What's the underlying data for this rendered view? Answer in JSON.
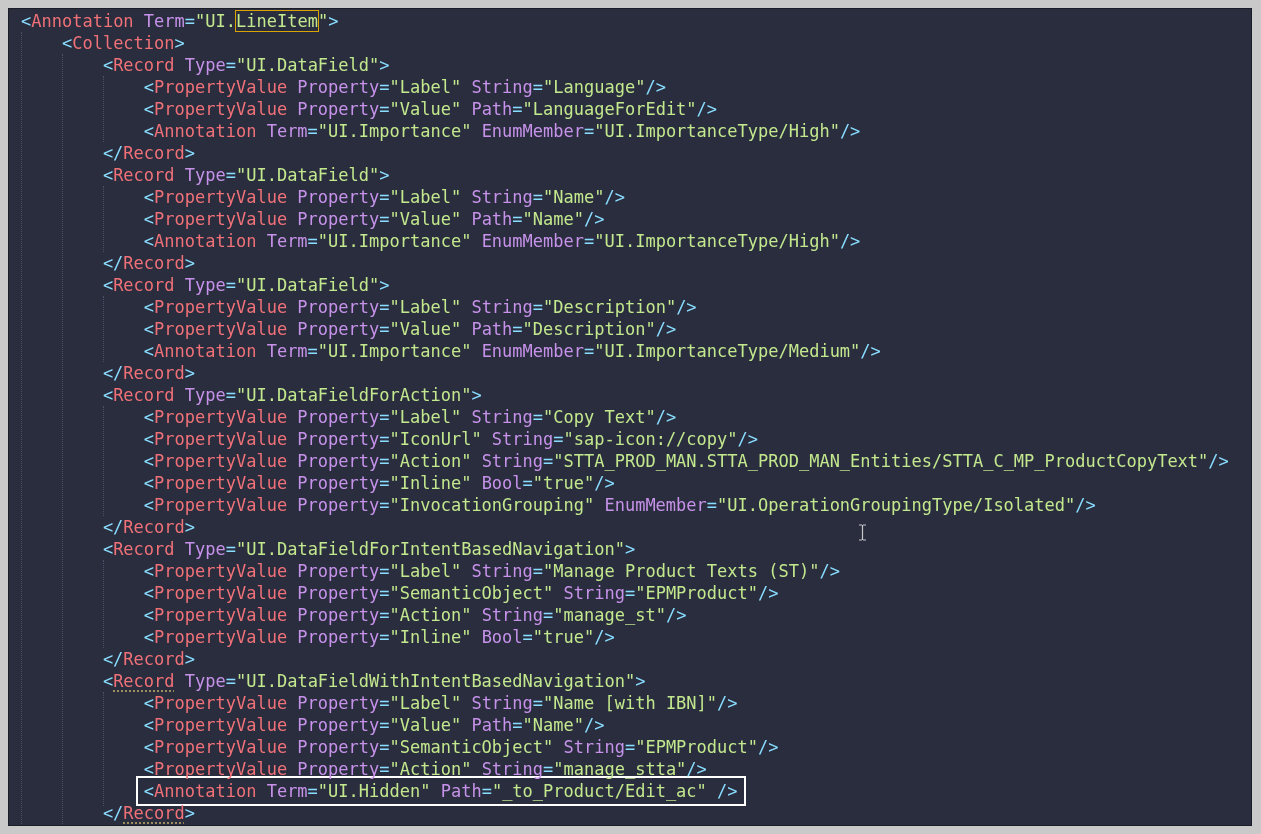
{
  "editor": {
    "lines": [
      {
        "open": [
          {
            "kind": "punct",
            "text": "<"
          },
          {
            "kind": "tag",
            "text": "Annotation"
          },
          {
            "kind": "attr",
            "text": " Term"
          },
          {
            "kind": "punct",
            "text": "="
          },
          {
            "kind": "string",
            "text": "\"UI."
          },
          {
            "kind": "string-matched",
            "text": "LineItem"
          },
          {
            "kind": "string",
            "text": "\""
          },
          {
            "kind": "punct",
            "text": ">"
          }
        ],
        "children": [
          {
            "open": [
              {
                "kind": "punct",
                "text": "<"
              },
              {
                "kind": "tag",
                "text": "Collection"
              },
              {
                "kind": "punct",
                "text": ">"
              }
            ],
            "children": [
              {
                "open": [
                  {
                    "kind": "punct",
                    "text": "<"
                  },
                  {
                    "kind": "tag",
                    "text": "Record"
                  },
                  {
                    "kind": "attr",
                    "text": " Type"
                  },
                  {
                    "kind": "punct",
                    "text": "="
                  },
                  {
                    "kind": "string",
                    "text": "\"UI.DataField\""
                  },
                  {
                    "kind": "punct",
                    "text": ">"
                  }
                ],
                "children": [
                  {
                    "open": [
                      {
                        "kind": "punct",
                        "text": "<"
                      },
                      {
                        "kind": "tag",
                        "text": "PropertyValue"
                      },
                      {
                        "kind": "attr",
                        "text": " Property"
                      },
                      {
                        "kind": "punct",
                        "text": "="
                      },
                      {
                        "kind": "string",
                        "text": "\"Label\""
                      },
                      {
                        "kind": "attr",
                        "text": " String"
                      },
                      {
                        "kind": "punct",
                        "text": "="
                      },
                      {
                        "kind": "string",
                        "text": "\"Language\""
                      },
                      {
                        "kind": "punct",
                        "text": "/>"
                      }
                    ]
                  },
                  {
                    "open": [
                      {
                        "kind": "punct",
                        "text": "<"
                      },
                      {
                        "kind": "tag",
                        "text": "PropertyValue"
                      },
                      {
                        "kind": "attr",
                        "text": " Property"
                      },
                      {
                        "kind": "punct",
                        "text": "="
                      },
                      {
                        "kind": "string",
                        "text": "\"Value\""
                      },
                      {
                        "kind": "attr",
                        "text": " Path"
                      },
                      {
                        "kind": "punct",
                        "text": "="
                      },
                      {
                        "kind": "string",
                        "text": "\"LanguageForEdit\""
                      },
                      {
                        "kind": "punct",
                        "text": "/>"
                      }
                    ]
                  },
                  {
                    "open": [
                      {
                        "kind": "punct",
                        "text": "<"
                      },
                      {
                        "kind": "tag",
                        "text": "Annotation"
                      },
                      {
                        "kind": "attr",
                        "text": " Term"
                      },
                      {
                        "kind": "punct",
                        "text": "="
                      },
                      {
                        "kind": "string",
                        "text": "\"UI.Importance\""
                      },
                      {
                        "kind": "attr",
                        "text": " EnumMember"
                      },
                      {
                        "kind": "punct",
                        "text": "="
                      },
                      {
                        "kind": "string",
                        "text": "\"UI.ImportanceType/High\""
                      },
                      {
                        "kind": "punct",
                        "text": "/>"
                      }
                    ]
                  }
                ],
                "close": [
                  {
                    "kind": "punct",
                    "text": "</"
                  },
                  {
                    "kind": "tag",
                    "text": "Record"
                  },
                  {
                    "kind": "punct",
                    "text": ">"
                  }
                ]
              },
              {
                "open": [
                  {
                    "kind": "punct",
                    "text": "<"
                  },
                  {
                    "kind": "tag",
                    "text": "Record"
                  },
                  {
                    "kind": "attr",
                    "text": " Type"
                  },
                  {
                    "kind": "punct",
                    "text": "="
                  },
                  {
                    "kind": "string",
                    "text": "\"UI.DataField\""
                  },
                  {
                    "kind": "punct",
                    "text": ">"
                  }
                ],
                "children": [
                  {
                    "open": [
                      {
                        "kind": "punct",
                        "text": "<"
                      },
                      {
                        "kind": "tag",
                        "text": "PropertyValue"
                      },
                      {
                        "kind": "attr",
                        "text": " Property"
                      },
                      {
                        "kind": "punct",
                        "text": "="
                      },
                      {
                        "kind": "string",
                        "text": "\"Label\""
                      },
                      {
                        "kind": "attr",
                        "text": " String"
                      },
                      {
                        "kind": "punct",
                        "text": "="
                      },
                      {
                        "kind": "string",
                        "text": "\"Name\""
                      },
                      {
                        "kind": "punct",
                        "text": "/>"
                      }
                    ]
                  },
                  {
                    "open": [
                      {
                        "kind": "punct",
                        "text": "<"
                      },
                      {
                        "kind": "tag",
                        "text": "PropertyValue"
                      },
                      {
                        "kind": "attr",
                        "text": " Property"
                      },
                      {
                        "kind": "punct",
                        "text": "="
                      },
                      {
                        "kind": "string",
                        "text": "\"Value\""
                      },
                      {
                        "kind": "attr",
                        "text": " Path"
                      },
                      {
                        "kind": "punct",
                        "text": "="
                      },
                      {
                        "kind": "string",
                        "text": "\"Name\""
                      },
                      {
                        "kind": "punct",
                        "text": "/>"
                      }
                    ]
                  },
                  {
                    "open": [
                      {
                        "kind": "punct",
                        "text": "<"
                      },
                      {
                        "kind": "tag",
                        "text": "Annotation"
                      },
                      {
                        "kind": "attr",
                        "text": " Term"
                      },
                      {
                        "kind": "punct",
                        "text": "="
                      },
                      {
                        "kind": "string",
                        "text": "\"UI.Importance\""
                      },
                      {
                        "kind": "attr",
                        "text": " EnumMember"
                      },
                      {
                        "kind": "punct",
                        "text": "="
                      },
                      {
                        "kind": "string",
                        "text": "\"UI.ImportanceType/High\""
                      },
                      {
                        "kind": "punct",
                        "text": "/>"
                      }
                    ]
                  }
                ],
                "close": [
                  {
                    "kind": "punct",
                    "text": "</"
                  },
                  {
                    "kind": "tag",
                    "text": "Record"
                  },
                  {
                    "kind": "punct",
                    "text": ">"
                  }
                ]
              },
              {
                "open": [
                  {
                    "kind": "punct",
                    "text": "<"
                  },
                  {
                    "kind": "tag",
                    "text": "Record"
                  },
                  {
                    "kind": "attr",
                    "text": " Type"
                  },
                  {
                    "kind": "punct",
                    "text": "="
                  },
                  {
                    "kind": "string",
                    "text": "\"UI.DataField\""
                  },
                  {
                    "kind": "punct",
                    "text": ">"
                  }
                ],
                "children": [
                  {
                    "open": [
                      {
                        "kind": "punct",
                        "text": "<"
                      },
                      {
                        "kind": "tag",
                        "text": "PropertyValue"
                      },
                      {
                        "kind": "attr",
                        "text": " Property"
                      },
                      {
                        "kind": "punct",
                        "text": "="
                      },
                      {
                        "kind": "string",
                        "text": "\"Label\""
                      },
                      {
                        "kind": "attr",
                        "text": " String"
                      },
                      {
                        "kind": "punct",
                        "text": "="
                      },
                      {
                        "kind": "string",
                        "text": "\"Description\""
                      },
                      {
                        "kind": "punct",
                        "text": "/>"
                      }
                    ]
                  },
                  {
                    "open": [
                      {
                        "kind": "punct",
                        "text": "<"
                      },
                      {
                        "kind": "tag",
                        "text": "PropertyValue"
                      },
                      {
                        "kind": "attr",
                        "text": " Property"
                      },
                      {
                        "kind": "punct",
                        "text": "="
                      },
                      {
                        "kind": "string",
                        "text": "\"Value\""
                      },
                      {
                        "kind": "attr",
                        "text": " Path"
                      },
                      {
                        "kind": "punct",
                        "text": "="
                      },
                      {
                        "kind": "string",
                        "text": "\"Description\""
                      },
                      {
                        "kind": "punct",
                        "text": "/>"
                      }
                    ]
                  },
                  {
                    "open": [
                      {
                        "kind": "punct",
                        "text": "<"
                      },
                      {
                        "kind": "tag",
                        "text": "Annotation"
                      },
                      {
                        "kind": "attr",
                        "text": " Term"
                      },
                      {
                        "kind": "punct",
                        "text": "="
                      },
                      {
                        "kind": "string",
                        "text": "\"UI.Importance\""
                      },
                      {
                        "kind": "attr",
                        "text": " EnumMember"
                      },
                      {
                        "kind": "punct",
                        "text": "="
                      },
                      {
                        "kind": "string",
                        "text": "\"UI.ImportanceType/Medium\""
                      },
                      {
                        "kind": "punct",
                        "text": "/>"
                      }
                    ]
                  }
                ],
                "close": [
                  {
                    "kind": "punct",
                    "text": "</"
                  },
                  {
                    "kind": "tag",
                    "text": "Record"
                  },
                  {
                    "kind": "punct",
                    "text": ">"
                  }
                ]
              },
              {
                "open": [
                  {
                    "kind": "punct",
                    "text": "<"
                  },
                  {
                    "kind": "tag",
                    "text": "Record"
                  },
                  {
                    "kind": "attr",
                    "text": " Type"
                  },
                  {
                    "kind": "punct",
                    "text": "="
                  },
                  {
                    "kind": "string",
                    "text": "\"UI.DataFieldForAction\""
                  },
                  {
                    "kind": "punct",
                    "text": ">"
                  }
                ],
                "children": [
                  {
                    "open": [
                      {
                        "kind": "punct",
                        "text": "<"
                      },
                      {
                        "kind": "tag",
                        "text": "PropertyValue"
                      },
                      {
                        "kind": "attr",
                        "text": " Property"
                      },
                      {
                        "kind": "punct",
                        "text": "="
                      },
                      {
                        "kind": "string",
                        "text": "\"Label\""
                      },
                      {
                        "kind": "attr",
                        "text": " String"
                      },
                      {
                        "kind": "punct",
                        "text": "="
                      },
                      {
                        "kind": "string",
                        "text": "\"Copy Text\""
                      },
                      {
                        "kind": "punct",
                        "text": "/>"
                      }
                    ]
                  },
                  {
                    "open": [
                      {
                        "kind": "punct",
                        "text": "<"
                      },
                      {
                        "kind": "tag",
                        "text": "PropertyValue"
                      },
                      {
                        "kind": "attr",
                        "text": " Property"
                      },
                      {
                        "kind": "punct",
                        "text": "="
                      },
                      {
                        "kind": "string",
                        "text": "\"IconUrl\""
                      },
                      {
                        "kind": "attr",
                        "text": " String"
                      },
                      {
                        "kind": "punct",
                        "text": "="
                      },
                      {
                        "kind": "string",
                        "text": "\"sap-icon://copy\""
                      },
                      {
                        "kind": "punct",
                        "text": "/>"
                      }
                    ]
                  },
                  {
                    "open": [
                      {
                        "kind": "punct",
                        "text": "<"
                      },
                      {
                        "kind": "tag",
                        "text": "PropertyValue"
                      },
                      {
                        "kind": "attr",
                        "text": " Property"
                      },
                      {
                        "kind": "punct",
                        "text": "="
                      },
                      {
                        "kind": "string",
                        "text": "\"Action\""
                      },
                      {
                        "kind": "attr",
                        "text": " String"
                      },
                      {
                        "kind": "punct",
                        "text": "="
                      },
                      {
                        "kind": "string",
                        "text": "\"STTA_PROD_MAN.STTA_PROD_MAN_Entities/STTA_C_MP_ProductCopyText\""
                      },
                      {
                        "kind": "punct",
                        "text": "/>"
                      }
                    ]
                  },
                  {
                    "open": [
                      {
                        "kind": "punct",
                        "text": "<"
                      },
                      {
                        "kind": "tag",
                        "text": "PropertyValue"
                      },
                      {
                        "kind": "attr",
                        "text": " Property"
                      },
                      {
                        "kind": "punct",
                        "text": "="
                      },
                      {
                        "kind": "string",
                        "text": "\"Inline\""
                      },
                      {
                        "kind": "attr",
                        "text": " Bool"
                      },
                      {
                        "kind": "punct",
                        "text": "="
                      },
                      {
                        "kind": "string",
                        "text": "\"true\""
                      },
                      {
                        "kind": "punct",
                        "text": "/>"
                      }
                    ]
                  },
                  {
                    "open": [
                      {
                        "kind": "punct",
                        "text": "<"
                      },
                      {
                        "kind": "tag",
                        "text": "PropertyValue"
                      },
                      {
                        "kind": "attr",
                        "text": " Property"
                      },
                      {
                        "kind": "punct",
                        "text": "="
                      },
                      {
                        "kind": "string",
                        "text": "\"InvocationGrouping\""
                      },
                      {
                        "kind": "attr",
                        "text": " EnumMember"
                      },
                      {
                        "kind": "punct",
                        "text": "="
                      },
                      {
                        "kind": "string",
                        "text": "\"UI.OperationGroupingType/Isolated\""
                      },
                      {
                        "kind": "punct",
                        "text": "/>"
                      }
                    ]
                  }
                ],
                "close": [
                  {
                    "kind": "punct",
                    "text": "</"
                  },
                  {
                    "kind": "tag",
                    "text": "Record"
                  },
                  {
                    "kind": "punct",
                    "text": ">"
                  }
                ]
              },
              {
                "open": [
                  {
                    "kind": "punct",
                    "text": "<"
                  },
                  {
                    "kind": "tag",
                    "text": "Record"
                  },
                  {
                    "kind": "attr",
                    "text": " Type"
                  },
                  {
                    "kind": "punct",
                    "text": "="
                  },
                  {
                    "kind": "string",
                    "text": "\"UI.DataFieldForIntentBasedNavigation\""
                  },
                  {
                    "kind": "punct",
                    "text": ">"
                  }
                ],
                "children": [
                  {
                    "open": [
                      {
                        "kind": "punct",
                        "text": "<"
                      },
                      {
                        "kind": "tag",
                        "text": "PropertyValue"
                      },
                      {
                        "kind": "attr",
                        "text": " Property"
                      },
                      {
                        "kind": "punct",
                        "text": "="
                      },
                      {
                        "kind": "string",
                        "text": "\"Label\""
                      },
                      {
                        "kind": "attr",
                        "text": " String"
                      },
                      {
                        "kind": "punct",
                        "text": "="
                      },
                      {
                        "kind": "string",
                        "text": "\"Manage Product Texts (ST)\""
                      },
                      {
                        "kind": "punct",
                        "text": "/>"
                      }
                    ]
                  },
                  {
                    "open": [
                      {
                        "kind": "punct",
                        "text": "<"
                      },
                      {
                        "kind": "tag",
                        "text": "PropertyValue"
                      },
                      {
                        "kind": "attr",
                        "text": " Property"
                      },
                      {
                        "kind": "punct",
                        "text": "="
                      },
                      {
                        "kind": "string",
                        "text": "\"SemanticObject\""
                      },
                      {
                        "kind": "attr",
                        "text": " String"
                      },
                      {
                        "kind": "punct",
                        "text": "="
                      },
                      {
                        "kind": "string",
                        "text": "\"EPMProduct\""
                      },
                      {
                        "kind": "punct",
                        "text": "/>"
                      }
                    ]
                  },
                  {
                    "open": [
                      {
                        "kind": "punct",
                        "text": "<"
                      },
                      {
                        "kind": "tag",
                        "text": "PropertyValue"
                      },
                      {
                        "kind": "attr",
                        "text": " Property"
                      },
                      {
                        "kind": "punct",
                        "text": "="
                      },
                      {
                        "kind": "string",
                        "text": "\"Action\""
                      },
                      {
                        "kind": "attr",
                        "text": " String"
                      },
                      {
                        "kind": "punct",
                        "text": "="
                      },
                      {
                        "kind": "string",
                        "text": "\"manage_st\""
                      },
                      {
                        "kind": "punct",
                        "text": "/>"
                      }
                    ]
                  },
                  {
                    "open": [
                      {
                        "kind": "punct",
                        "text": "<"
                      },
                      {
                        "kind": "tag",
                        "text": "PropertyValue"
                      },
                      {
                        "kind": "attr",
                        "text": " Property"
                      },
                      {
                        "kind": "punct",
                        "text": "="
                      },
                      {
                        "kind": "string",
                        "text": "\"Inline\""
                      },
                      {
                        "kind": "attr",
                        "text": " Bool"
                      },
                      {
                        "kind": "punct",
                        "text": "="
                      },
                      {
                        "kind": "string",
                        "text": "\"true\""
                      },
                      {
                        "kind": "punct",
                        "text": "/>"
                      }
                    ]
                  }
                ],
                "close": [
                  {
                    "kind": "punct",
                    "text": "</"
                  },
                  {
                    "kind": "tag",
                    "text": "Record"
                  },
                  {
                    "kind": "punct",
                    "text": ">"
                  }
                ]
              },
              {
                "open": [
                  {
                    "kind": "punct",
                    "text": "<"
                  },
                  {
                    "kind": "tag-warned",
                    "text": "Record"
                  },
                  {
                    "kind": "attr",
                    "text": " Type"
                  },
                  {
                    "kind": "punct",
                    "text": "="
                  },
                  {
                    "kind": "string",
                    "text": "\"UI.DataFieldWithIntentBasedNavigation\""
                  },
                  {
                    "kind": "punct",
                    "text": ">"
                  }
                ],
                "children": [
                  {
                    "framed": false,
                    "open": [
                      {
                        "kind": "punct",
                        "text": "<"
                      },
                      {
                        "kind": "tag",
                        "text": "PropertyValue"
                      },
                      {
                        "kind": "attr",
                        "text": " Property"
                      },
                      {
                        "kind": "punct",
                        "text": "="
                      },
                      {
                        "kind": "string",
                        "text": "\"Label\""
                      },
                      {
                        "kind": "attr",
                        "text": " String"
                      },
                      {
                        "kind": "punct",
                        "text": "="
                      },
                      {
                        "kind": "string",
                        "text": "\"Name [with IBN]\""
                      },
                      {
                        "kind": "punct",
                        "text": "/>"
                      }
                    ]
                  },
                  {
                    "framed": false,
                    "open": [
                      {
                        "kind": "punct",
                        "text": "<"
                      },
                      {
                        "kind": "tag",
                        "text": "PropertyValue"
                      },
                      {
                        "kind": "attr",
                        "text": " Property"
                      },
                      {
                        "kind": "punct",
                        "text": "="
                      },
                      {
                        "kind": "string",
                        "text": "\"Value\""
                      },
                      {
                        "kind": "attr",
                        "text": " Path"
                      },
                      {
                        "kind": "punct",
                        "text": "="
                      },
                      {
                        "kind": "string",
                        "text": "\"Name\""
                      },
                      {
                        "kind": "punct",
                        "text": "/>"
                      }
                    ]
                  },
                  {
                    "framed": false,
                    "open": [
                      {
                        "kind": "punct",
                        "text": "<"
                      },
                      {
                        "kind": "tag",
                        "text": "PropertyValue"
                      },
                      {
                        "kind": "attr",
                        "text": " Property"
                      },
                      {
                        "kind": "punct",
                        "text": "="
                      },
                      {
                        "kind": "string",
                        "text": "\"SemanticObject\""
                      },
                      {
                        "kind": "attr",
                        "text": " String"
                      },
                      {
                        "kind": "punct",
                        "text": "="
                      },
                      {
                        "kind": "string",
                        "text": "\"EPMProduct\""
                      },
                      {
                        "kind": "punct",
                        "text": "/>"
                      }
                    ]
                  },
                  {
                    "framed": false,
                    "open": [
                      {
                        "kind": "punct",
                        "text": "<"
                      },
                      {
                        "kind": "tag",
                        "text": "PropertyValue"
                      },
                      {
                        "kind": "attr",
                        "text": " Property"
                      },
                      {
                        "kind": "punct",
                        "text": "="
                      },
                      {
                        "kind": "string",
                        "text": "\"Action\""
                      },
                      {
                        "kind": "attr",
                        "text": " String"
                      },
                      {
                        "kind": "punct",
                        "text": "="
                      },
                      {
                        "kind": "string",
                        "text": "\"manage_stta\""
                      },
                      {
                        "kind": "punct",
                        "text": "/>"
                      }
                    ]
                  },
                  {
                    "framed": true,
                    "open": [
                      {
                        "kind": "punct",
                        "text": "<"
                      },
                      {
                        "kind": "tag",
                        "text": "Annotation"
                      },
                      {
                        "kind": "attr",
                        "text": " Term"
                      },
                      {
                        "kind": "punct",
                        "text": "="
                      },
                      {
                        "kind": "string",
                        "text": "\"UI.Hidden\""
                      },
                      {
                        "kind": "attr",
                        "text": " Path"
                      },
                      {
                        "kind": "punct",
                        "text": "="
                      },
                      {
                        "kind": "string",
                        "text": "\"_to_Product/Edit_ac\""
                      },
                      {
                        "kind": "punct",
                        "text": " />"
                      }
                    ]
                  }
                ],
                "close": [
                  {
                    "kind": "punct",
                    "text": "</"
                  },
                  {
                    "kind": "tag-warned",
                    "text": "Record"
                  },
                  {
                    "kind": "punct",
                    "text": ">"
                  }
                ]
              }
            ]
          }
        ]
      }
    ]
  }
}
